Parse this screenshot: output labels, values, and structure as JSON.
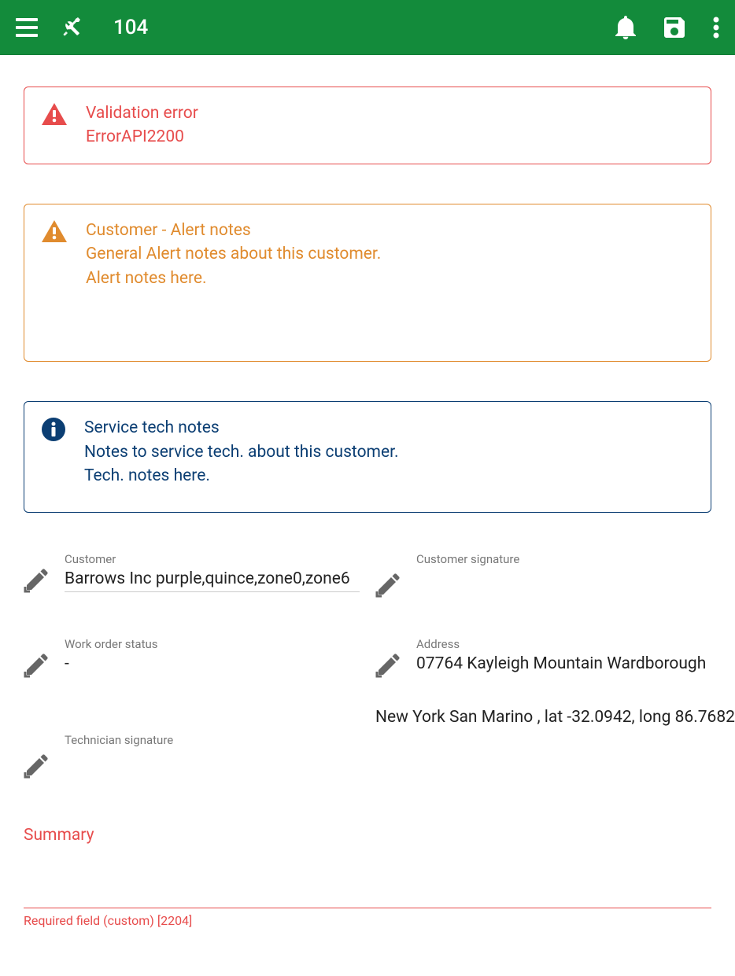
{
  "header": {
    "title": "104"
  },
  "alerts": {
    "error": {
      "title": "Validation error",
      "detail": "ErrorAPI2200"
    },
    "warning": {
      "title": "Customer - Alert notes",
      "line1": "General Alert notes about this customer.",
      "line2": "Alert notes here."
    },
    "info": {
      "title": "Service tech notes",
      "line1": "Notes to service tech. about this customer.",
      "line2": "Tech. notes here."
    }
  },
  "fields": {
    "customer": {
      "label": "Customer",
      "value": "Barrows Inc purple,quince,zone0,zone6"
    },
    "customer_signature": {
      "label": "Customer signature"
    },
    "work_order_status": {
      "label": "Work order status",
      "value": "-"
    },
    "address": {
      "label": "Address",
      "value": "07764 Kayleigh Mountain Wardborough",
      "extra": "New York San Marino , lat -32.0942, long 86.7682"
    },
    "technician_signature": {
      "label": "Technician signature"
    }
  },
  "summary": {
    "label": "Summary",
    "required_msg": "Required field (custom) [2204]"
  },
  "colors": {
    "primary": "#138b3b",
    "error": "#e74c4c",
    "warning": "#e08b2e",
    "info": "#0b3e73"
  }
}
